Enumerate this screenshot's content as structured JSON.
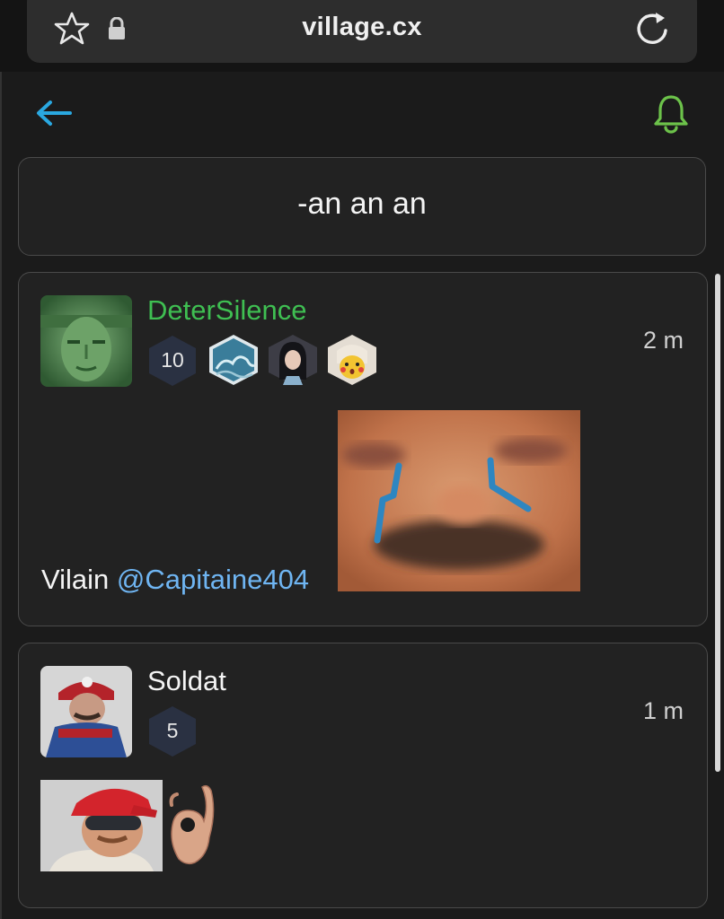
{
  "browser": {
    "url": "village.cx",
    "icons": [
      "star-icon",
      "lock-icon",
      "reload-icon"
    ]
  },
  "header": {
    "back_icon": "arrow-left-icon",
    "notification_icon": "bell-icon",
    "accent_back": "#2aa8e0",
    "accent_bell": "#6cc24a"
  },
  "thread": {
    "title": "-an an an"
  },
  "posts": [
    {
      "username": "DeterSilence",
      "username_color": "#3fbf52",
      "level": "10",
      "time": "2 m",
      "badges": [
        "wave-badge",
        "girl-badge",
        "pikachu-badge"
      ],
      "text": "Vilain ",
      "mention": "@Capitaine404",
      "sticker": "crying-face-sticker"
    },
    {
      "username": "Soldat",
      "username_color": "#f4f4f4",
      "level": "5",
      "time": "1 m",
      "stickers": [
        "save-canada-man-sticker",
        "ok-hand-sticker"
      ]
    }
  ]
}
